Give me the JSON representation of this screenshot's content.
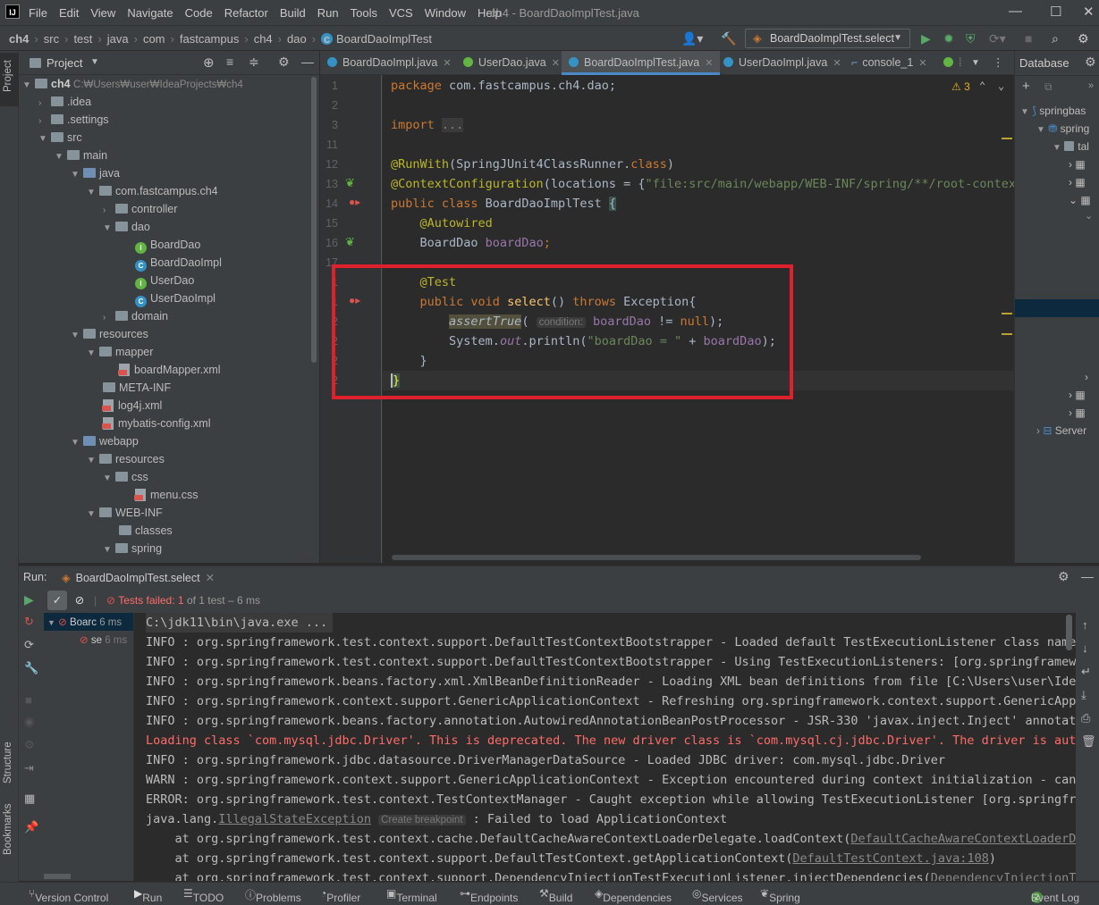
{
  "window": {
    "title": "ch4 - BoardDaoImplTest.java",
    "menu": [
      "File",
      "Edit",
      "View",
      "Navigate",
      "Code",
      "Refactor",
      "Build",
      "Run",
      "Tools",
      "VCS",
      "Window",
      "Help"
    ]
  },
  "breadcrumb": [
    "ch4",
    "src",
    "test",
    "java",
    "com",
    "fastcampus",
    "ch4",
    "dao",
    "BoardDaoImplTest"
  ],
  "run_config": "BoardDaoImplTest.select",
  "project_panel": {
    "title": "Project",
    "root_name": "ch4",
    "root_path": "C:₩Users₩user₩IdeaProjects₩ch4",
    "items": [
      ".idea",
      ".settings",
      "src",
      "main",
      "java",
      "com.fastcampus.ch4",
      "controller",
      "dao",
      "BoardDao",
      "BoardDaoImpl",
      "UserDao",
      "UserDaoImpl",
      "domain",
      "resources",
      "mapper",
      "boardMapper.xml",
      "META-INF",
      "log4j.xml",
      "mybatis-config.xml",
      "webapp",
      "resources",
      "css",
      "menu.css",
      "WEB-INF",
      "classes",
      "spring"
    ]
  },
  "tabs": [
    "BoardDaoImpl.java",
    "UserDao.java",
    "BoardDaoImplTest.java",
    "UserDaoImpl.java",
    "console_1"
  ],
  "editor": {
    "line_numbers": [
      "1",
      "2",
      "3",
      "11",
      "12",
      "13",
      "14",
      "15",
      "16",
      "17",
      "1",
      "1",
      "2",
      "2",
      "2",
      "2"
    ],
    "lines": {
      "l1_kw": "package",
      "l1_rest": " com.fastcampus.ch4.dao;",
      "l3_kw": "import",
      "l3_fold": "...",
      "l12_an": "@RunWith",
      "l12_a": "(SpringJUnit4ClassRunner.",
      "l12_kw": "class",
      "l12_b": ")",
      "l13_an": "@ContextConfiguration",
      "l13_a": "(locations = {",
      "l13_str": "\"file:src/main/webapp/WEB-INF/spring/**/root-context",
      "l14_kw": "public class",
      "l14_rest": " BoardDaoImplTest ",
      "l14_brace": "{",
      "l15_an": "@Autowired",
      "l16_type": "BoardDao ",
      "l16_fld": "boardDao",
      "l16_end": ";",
      "l18_an": "@Test",
      "l19_kw1": "public void ",
      "l19_fn": "select",
      "l19_mid": "() ",
      "l19_kw2": "throws",
      "l19_end": " Exception{",
      "l20_call": "assertTrue",
      "l20_open": "(",
      "l20_hint": "condition:",
      "l20_fld": "boardDao",
      "l20_mid": " != ",
      "l20_null": "null",
      "l20_end": ");",
      "l21_a": "System.",
      "l21_out": "out",
      "l21_b": ".println(",
      "l21_str": "\"boardDao = \"",
      "l21_c": " + ",
      "l21_fld": "boardDao",
      "l21_d": ");",
      "l22": "}",
      "l23": "}"
    },
    "warnings_count": "3"
  },
  "database_panel": {
    "title": "Database",
    "items": [
      "springbas",
      "spring",
      "tal",
      "Server"
    ]
  },
  "run_panel": {
    "label": "Run:",
    "tab": "BoardDaoImplTest.select",
    "tests_failed_label": "Tests failed:",
    "failed": "1",
    "of_text": "of 1 test – 6 ms",
    "tree": [
      {
        "name": "Boarc",
        "time": "6 ms"
      },
      {
        "name": "se",
        "time": "6 ms"
      }
    ],
    "console": [
      {
        "text": "C:\\jdk11\\bin\\java.exe ...",
        "type": "cmd"
      },
      {
        "text": "INFO : org.springframework.test.context.support.DefaultTestContextBootstrapper - Loaded default TestExecutionListener class names",
        "type": "info"
      },
      {
        "text": "INFO : org.springframework.test.context.support.DefaultTestContextBootstrapper - Using TestExecutionListeners: [org.springframewor",
        "type": "info"
      },
      {
        "text": "INFO : org.springframework.beans.factory.xml.XmlBeanDefinitionReader - Loading XML bean definitions from file [C:\\Users\\user\\IdeaP",
        "type": "info"
      },
      {
        "text": "INFO : org.springframework.context.support.GenericApplicationContext - Refreshing org.springframework.context.support.GenericAppli",
        "type": "info"
      },
      {
        "text": "INFO : org.springframework.beans.factory.annotation.AutowiredAnnotationBeanPostProcessor - JSR-330 'javax.inject.Inject' annotatio",
        "type": "info"
      },
      {
        "text": "Loading class `com.mysql.jdbc.Driver'. This is deprecated. The new driver class is `com.mysql.cj.jdbc.Driver'. The driver is autom",
        "type": "err"
      },
      {
        "text": "INFO : org.springframework.jdbc.datasource.DriverManagerDataSource - Loaded JDBC driver: com.mysql.jdbc.Driver",
        "type": "info"
      },
      {
        "text": "WARN : org.springframework.context.support.GenericApplicationContext - Exception encountered during context initialization - cance",
        "type": "info"
      },
      {
        "text": "ERROR: org.springframework.test.context.TestContextManager - Caught exception while allowing TestExecutionListener [org.springfram",
        "type": "info"
      }
    ],
    "exception_line": {
      "prefix": "java.lang.",
      "link": "IllegalStateException",
      "hint": "Create breakpoint",
      "rest": " : Failed to load ApplicationContext"
    },
    "stack": [
      {
        "text": "    at org.springframework.test.context.cache.DefaultCacheAwareContextLoaderDelegate.loadContext(",
        "link": "DefaultCacheAwareContextLoaderDel"
      },
      {
        "text": "    at org.springframework.test.context.support.DefaultTestContext.getApplicationContext(",
        "link": "DefaultTestContext.java:108",
        "end": ")"
      },
      {
        "text": "    at org.springframework.test.context.support.DependencyInjectionTestExecutionListener.injectDependencies(",
        "link": "DependencyInjectionTes"
      }
    ]
  },
  "left_stripe": [
    "Project",
    "Structure",
    "Bookmarks"
  ],
  "status_bar": [
    "Version Control",
    "Run",
    "TODO",
    "Problems",
    "Profiler",
    "Terminal",
    "Endpoints",
    "Build",
    "Dependencies",
    "Services",
    "Spring"
  ],
  "event_log": {
    "count": "2",
    "label": "Event Log"
  },
  "colors": {
    "accent": "#4a88c7",
    "highlight_box": "#e0202c",
    "error_text": "#ff6b68"
  }
}
